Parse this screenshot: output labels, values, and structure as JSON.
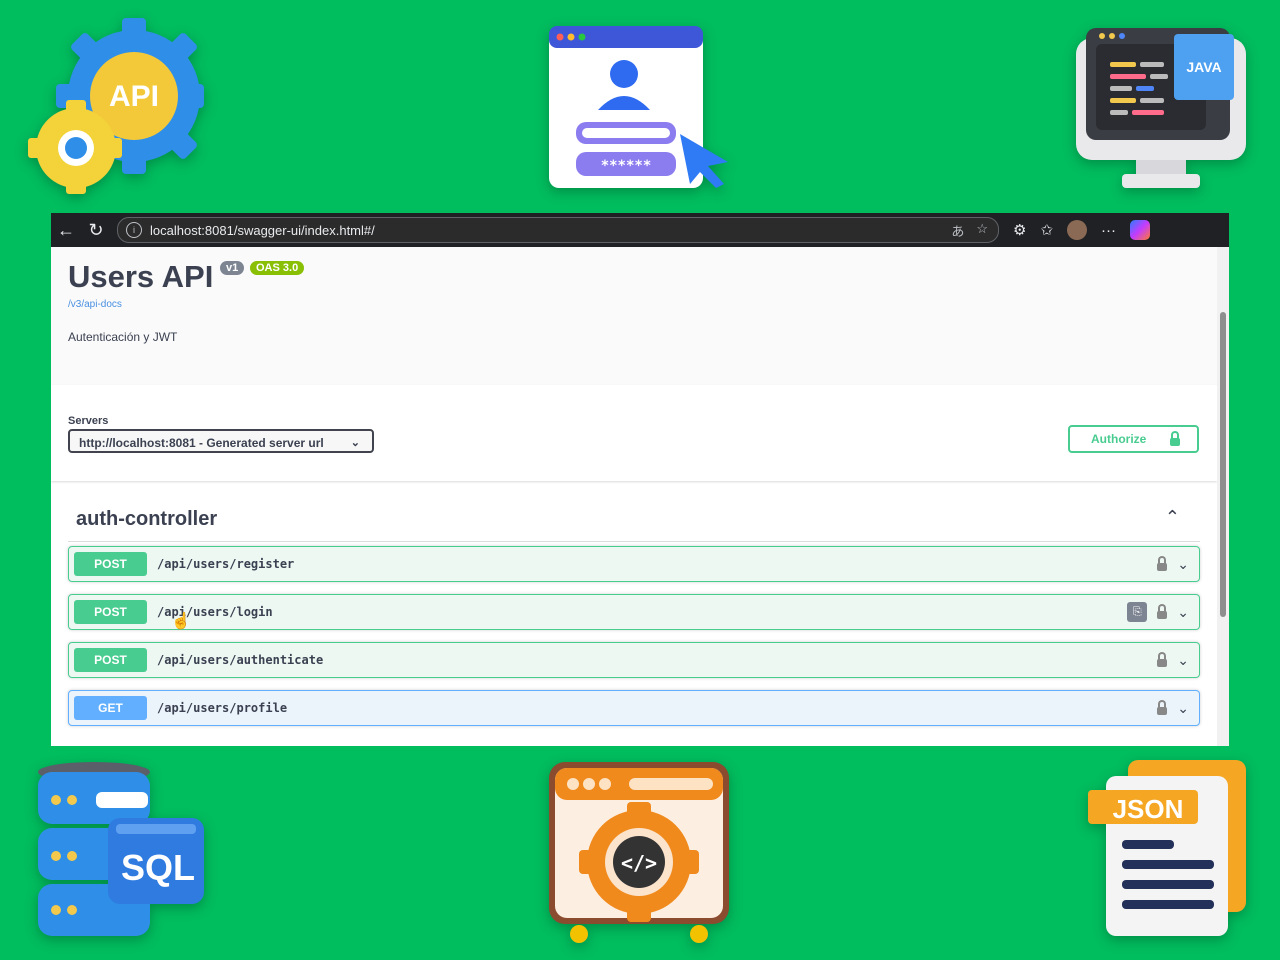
{
  "browser": {
    "url": "localhost:8081/swagger-ui/index.html#/",
    "back_icon": "←",
    "reload_icon": "↻",
    "more_icon": "···"
  },
  "api": {
    "title": "Users API",
    "version_badge": "v1",
    "oas_badge": "OAS 3.0",
    "docs_link": "/v3/api-docs",
    "description": "Autenticación y JWT"
  },
  "servers": {
    "label": "Servers",
    "selected": "http://localhost:8081 - Generated server url",
    "authorize_label": "Authorize"
  },
  "tag": {
    "name": "auth-controller",
    "toggle": "⌃"
  },
  "operations": [
    {
      "method": "POST",
      "path": "/api/users/register"
    },
    {
      "method": "POST",
      "path": "/api/users/login"
    },
    {
      "method": "POST",
      "path": "/api/users/authenticate"
    },
    {
      "method": "GET",
      "path": "/api/users/profile"
    }
  ],
  "decorations": {
    "api_gear_text": "API",
    "login_password": "******",
    "java_label": "JAVA",
    "sql_label": "SQL",
    "json_label": "JSON"
  },
  "colors": {
    "background": "#00bd5e",
    "post": "#49cc90",
    "get": "#61affe"
  }
}
